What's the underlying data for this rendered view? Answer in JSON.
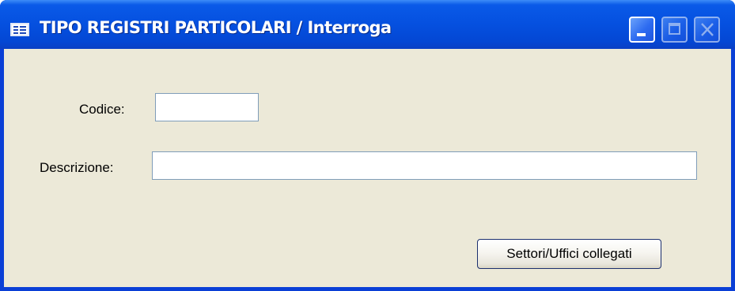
{
  "window": {
    "title": "TIPO REGISTRI PARTICOLARI / Interroga",
    "icon": "form-window-icon",
    "controls": [
      "minimize-icon",
      "maximize-icon",
      "close-icon"
    ]
  },
  "form": {
    "codice_label": "Codice:",
    "codice_value": "",
    "descrizione_label": "Descrizione:",
    "descrizione_value": ""
  },
  "actions": {
    "settori_label": "Settori/Uffici collegati"
  },
  "colors": {
    "titlebar": "#0550df",
    "client_background": "#ece9d8",
    "field_border": "#7f9db9"
  }
}
